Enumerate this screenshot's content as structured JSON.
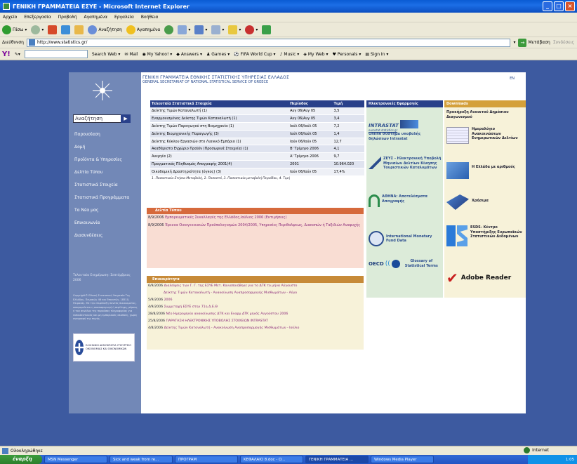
{
  "window": {
    "title": "ΓΕΝΙΚΗ ΓΡΑΜΜΑΤΕΙΑ ΕΣΥΕ - Microsoft Internet Explorer"
  },
  "menu": [
    "Αρχείο",
    "Επεξεργασία",
    "Προβολή",
    "Αγαπημένα",
    "Εργαλεία",
    "Βοήθεια"
  ],
  "toolbar": {
    "back": "Πίσω",
    "search": "Αναζήτηση",
    "favorites": "Αγαπημένα"
  },
  "address": {
    "label": "Διεύθυνση",
    "url": "http://www.statistics.gr/",
    "go": "Μετάβαση",
    "links": "Συνδέσεις"
  },
  "yahoo": {
    "search_web": "Search Web",
    "mail": "Mail",
    "my_yahoo": "My Yahoo!",
    "answers": "Answers",
    "games": "Games",
    "fifa": "FIFA World Cup",
    "music": "Music",
    "my_web": "My Web",
    "personals": "Personals",
    "sign_in": "Sign In"
  },
  "site": {
    "title_gr": "ΓΕΝΙΚΗ ΓΡΑΜΜΑΤΕΙΑ ΕΘΝΙΚΗΣ ΣΤΑΤΙΣΤΙΚΗΣ ΥΠΗΡΕΣΙΑΣ ΕΛΛΑΔΟΣ",
    "title_en": "GENERAL SECRETARIAT OF NATIONAL STATISTICAL SERVICE OF GREECE",
    "lang": "EN",
    "search_placeholder": "Αναζήτηση",
    "nav": [
      "Παρουσίαση",
      "Δομή",
      "Προϊόντα & Υπηρεσίες",
      "Δελτία Τύπου",
      "Στατιστικά Στοιχεία",
      "Στατιστικά Προγράμματα",
      "Τα Νέα μας",
      "Επικοινωνία",
      "Διασυνδέσεις"
    ],
    "updated": "Τελευταία Ενημέρωση: Σεπτέμβριος 2006",
    "copyright": "Copyright© Εθνική Στατιστική Υπηρεσία Της Ελλάδος, Πειραιώς 46 και Επονιτών, 18510, Πειραιάς. Με την επιφύλαξη παντός δικαιώματος, απαγορεύεται η αναπαραγωγή ή περίληψη, μέρους ή του συνόλου της παρούσας πληροφορίας για εκπαιδευτικούς και μη εμπορικούς σκοπούς, χωρίς αναγραφή της πηγής.",
    "ministry": "ΕΛΛΗΝΙΚΗ ΔΗΜΟΚΡΑΤΙΑ ΥΠΟΥΡΓΕΙΟ ΟΙΚΟΝΟΜΙΑΣ ΚΑΙ ΟΙΚΟΝΟΜΙΚΩΝ"
  },
  "stats": {
    "headers": [
      "Τελευταία Στατιστικά Στοιχεία",
      "Περίοδος",
      "Τιμή"
    ],
    "rows": [
      [
        "Δείκτης Τιμών Καταναλωτή (1)",
        "Αυγ 06/Αυγ 05",
        "3,5"
      ],
      [
        "Εναρμονισμένος Δείκτης Τιμών Καταναλωτή (1)",
        "Αυγ 06/Αυγ 05",
        "3,4"
      ],
      [
        "Δείκτης Τιμών Παραγωγού στη Βιομηχανία (1)",
        "Ιούλ 06/Ιούλ 05",
        "7,2"
      ],
      [
        "Δείκτης Βιομηχανικής Παραγωγής (3)",
        "Ιούλ 06/Ιούλ 05",
        "1,4"
      ],
      [
        "Δείκτης Κύκλου Εργασιών στο Λιανικό Εμπόριο (1)",
        "Ιούν 06/Ιούν 05",
        "12,7"
      ],
      [
        "Ακαθάριστο Εγχώριο Προϊόν (Προσωρινά Στοιχεία) (1)",
        "Β' Τρίμηνο 2006",
        "4,1"
      ],
      [
        "Ανεργία (2)",
        "Α' Τρίμηνο 2006",
        "9,7"
      ],
      [
        "Πραγματικός Πληθυσμός Απογραφής 2001(4)",
        "2001",
        "10.964.020"
      ],
      [
        "Οικοδομική Δραστηριότητα (όγκος) (3)",
        "Ιούν 06/Ιούν 05",
        "17,4%"
      ]
    ],
    "footnote": "1. Ποσοστιαία Ετήσια Μεταβολή,    2. Ποσοστό,    3. Ποσοστιαία μεταβολή Περιόδου,    4. Τιμή"
  },
  "news": {
    "title": "Δελτία Τύπου",
    "items": [
      {
        "date": "8/9/2006",
        "text": "Εμπορευματικές Συναλλαγές της Ελλάδος,Ιούλιος 2006 (Εκτιμήσεις)"
      },
      {
        "date": "8/9/2006",
        "text": "Έρευνα Οικογενειακών Προϋπολογισμών 2004/2005, Υπηρεσίες Περιθαλψεως, Διακοπών ή Ταξιδιών Αναψυχής"
      }
    ]
  },
  "topical": {
    "title": "Επικαιρότητα",
    "items": [
      {
        "date": "6/9/2006",
        "text": "Διαλείψεις των Γ. Γ. της ΕΣΥΕ Μετ. Κοινοποιήθηκε για το ΔΤΚ το μήνα Αύγουστο"
      },
      {
        "date": "",
        "text": "Δείκτης Τιμών Καταναλωτή - Ανακοίνωση Αναπροσαρμογής Μισθωμάτων - Αύγο"
      },
      {
        "date": "5/9/2006",
        "text": "2006"
      },
      {
        "date": "4/9/2006",
        "text": "Συμμετοχή ΕΣΥΕ στην 71η Δ.Ε.Θ"
      },
      {
        "date": "28/8/2006",
        "text": "Νέο Ημερομηνία ανακοίνωσης ΔΤΚ και Εναρμ ΔΤΚ μηνός Αυγούστου 2006"
      },
      {
        "date": "25/8/2006",
        "text": "ΠΑΡΑΤΑΣΗ ΗΛΕΚΤΡΟΝΙΚΗΣ ΥΠΟΒΟΛΗΣ ΣΤΟΙΧΕΙΩΝ INTRASTAT"
      },
      {
        "date": "4/8/2006",
        "text": "Δείκτης Τιμών Καταναλωτή - Ανακοίνωση Αναπροσαρμογής Μισθωμάτων - Ιούλιο"
      }
    ]
  },
  "apps": {
    "title": "Ηλεκτρονικές Εφαρμογές",
    "items": [
      {
        "logo": "INTRASTAT",
        "sub": "eurostat.statistics.gr",
        "text": "Online σύστημα υποβολής δηλώσεων Intrastat"
      },
      {
        "logo": "",
        "sub": "",
        "text": "ΖΕΥΣ - Ηλεκτρονική Υποβολή Μηνιαίων Δελτίων Κίνησης Τουριστικών Καταλυμάτων"
      },
      {
        "logo": "",
        "sub": "",
        "text": "ΑΘΗΝΑ: Αποτελέσματα Απογραφής"
      },
      {
        "logo": "",
        "sub": "",
        "text": "International Monetary Fund Data"
      },
      {
        "logo": "OECD",
        "sub": "",
        "text": "Glossary of Statistical Terms"
      }
    ]
  },
  "downloads": {
    "title": "Downloads",
    "items": [
      "Προκήρυξη Ανοικτού Δημόσιου Διαγωνισμού",
      "Ημερολόγιο Ανακοινώσεων Ενημερωτικών Δελτίων",
      "Η Ελλάδα με αριθμούς",
      "Χρήσιμα",
      "ESDS- Κέντρο Υποστήριξης Ευρωπαϊκών Στατιστικών Δεδομένων",
      "Adobe Reader"
    ]
  },
  "status": {
    "text": "Ολοκληρώθηκε",
    "zone": "Internet"
  },
  "taskbar": {
    "start": "έναρξη",
    "tasks": [
      "MSN Messenger",
      "Sick and weak from re...",
      "ΠΡΟΓΡΑΜ",
      "ΚΕΦΑΛΑΙΟ 8.doc - O...",
      "ΓΕΝΙΚΗ ΓΡΑΜΜΑΤΕΙΑ ...",
      "Windows Media Player"
    ],
    "clock": "1:05"
  }
}
